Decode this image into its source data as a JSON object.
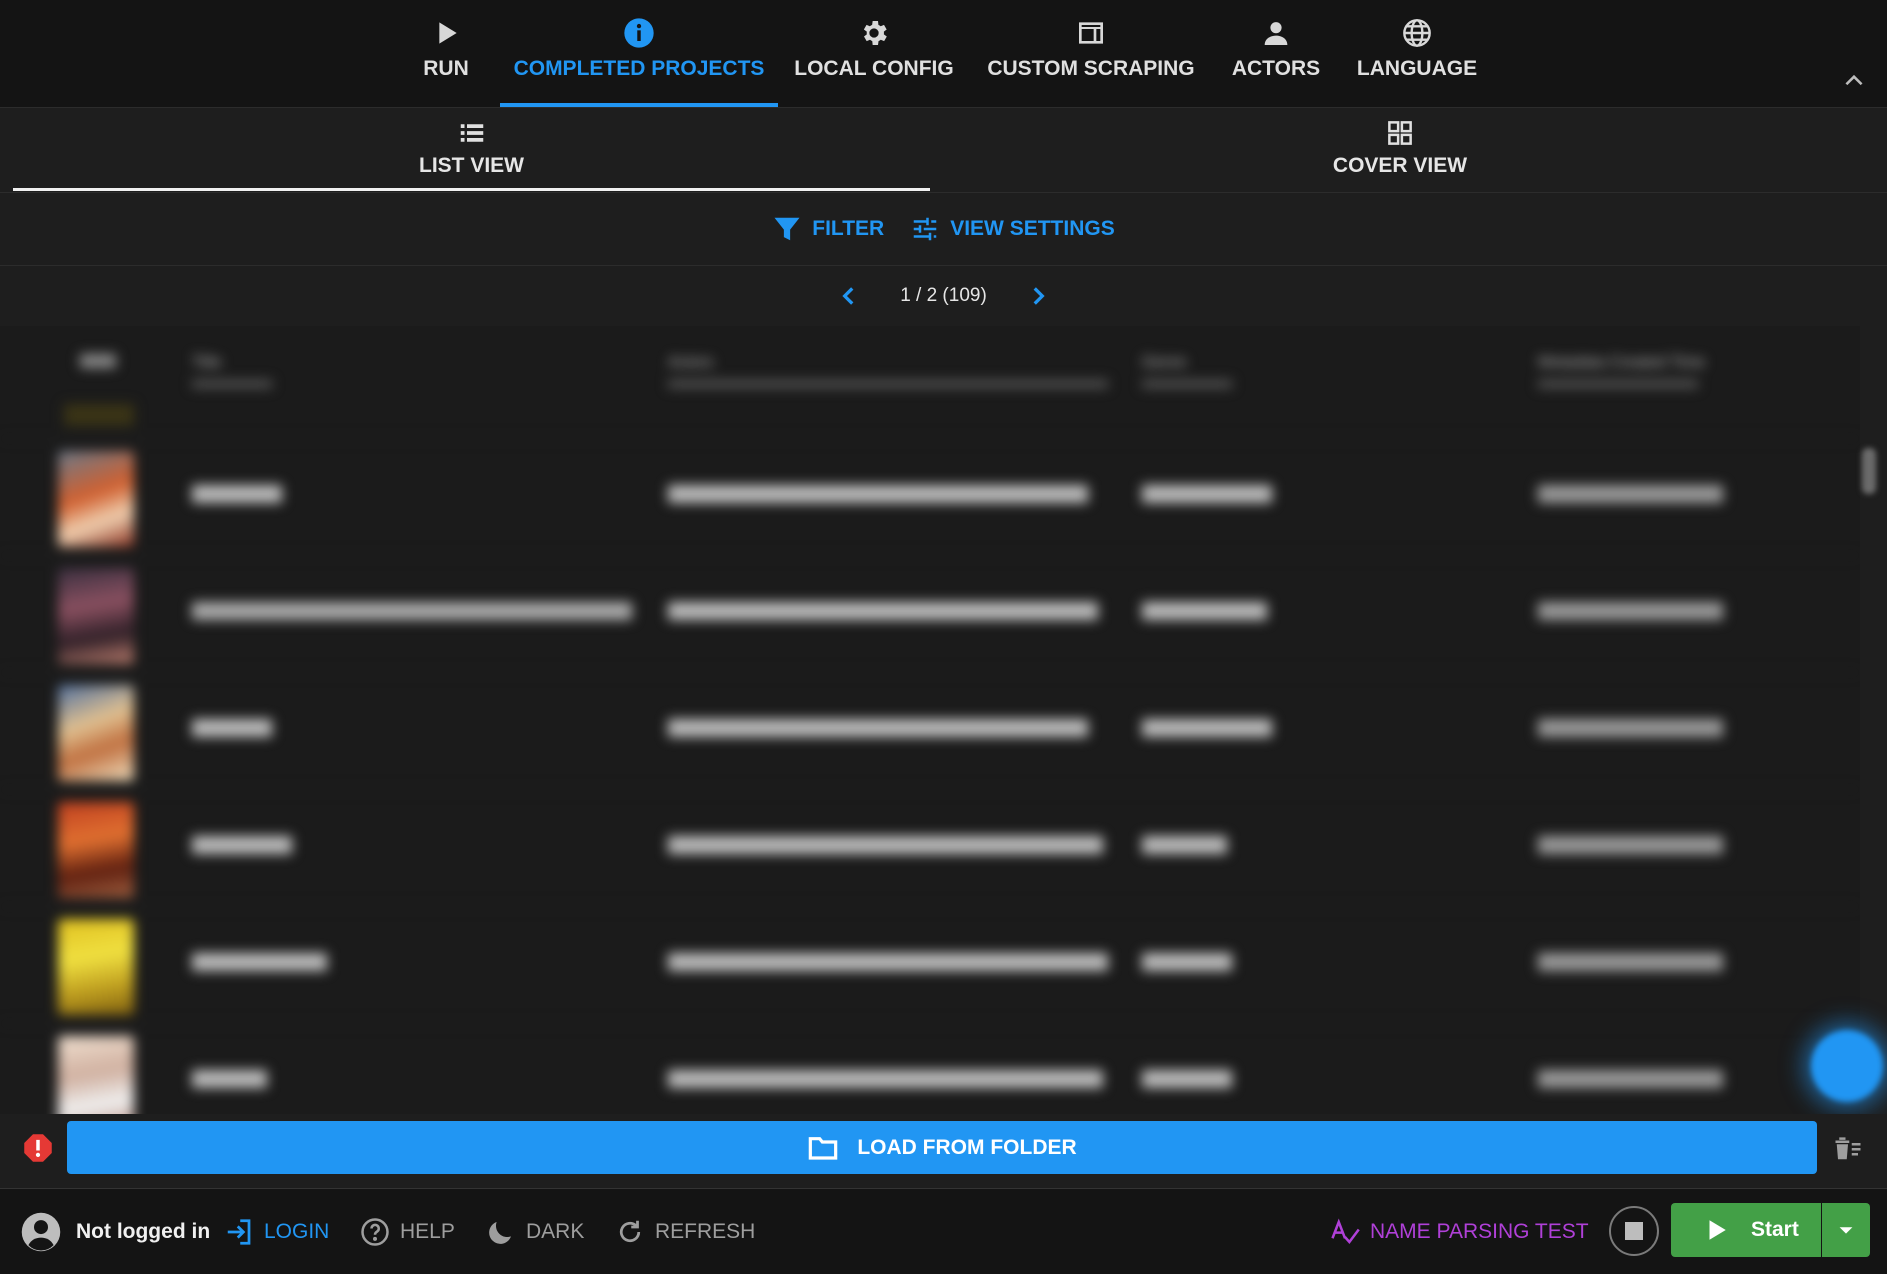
{
  "nav": {
    "tabs": [
      {
        "label": "RUN",
        "icon": "play-icon"
      },
      {
        "label": "COMPLETED PROJECTS",
        "icon": "info-icon"
      },
      {
        "label": "LOCAL CONFIG",
        "icon": "gear-icon"
      },
      {
        "label": "CUSTOM SCRAPING",
        "icon": "browser-window-icon"
      },
      {
        "label": "ACTORS",
        "icon": "person-icon"
      },
      {
        "label": "LANGUAGE",
        "icon": "globe-icon"
      }
    ],
    "active_tab": "COMPLETED PROJECTS"
  },
  "views": {
    "list_label": "LIST VIEW",
    "cover_label": "COVER VIEW",
    "active": "LIST VIEW"
  },
  "toolbar": {
    "filter_label": "FILTER",
    "view_settings_label": "VIEW SETTINGS"
  },
  "pagination": {
    "text": "1 / 2 (109)"
  },
  "table": {
    "headers": [
      "Title",
      "Actors",
      "Genre",
      "Metadata Created Time"
    ],
    "rows": 7
  },
  "load_button_label": "LOAD FROM FOLDER",
  "footer": {
    "user_status": "Not logged in",
    "login_label": "LOGIN",
    "help_label": "HELP",
    "dark_label": "DARK",
    "refresh_label": "REFRESH",
    "name_parsing_label": "NAME PARSING TEST",
    "start_label": "Start"
  },
  "colors": {
    "accent": "#2196f3",
    "start": "#43a047",
    "error": "#e53935",
    "name_parsing": "#b040d8",
    "background": "#1e1e1e",
    "bars": "#141414"
  }
}
